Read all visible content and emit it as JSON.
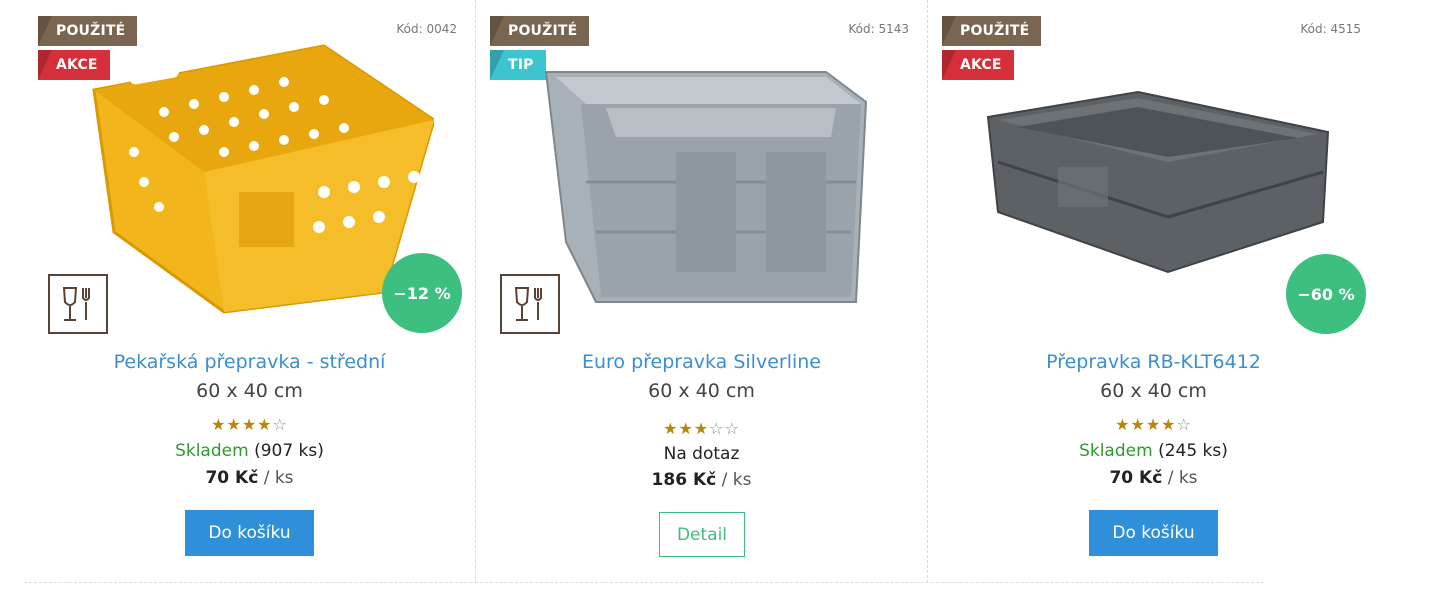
{
  "products": [
    {
      "badges": {
        "used": "POUŽITÉ",
        "second": "AKCE"
      },
      "code": "Kód: 0042",
      "discount": "−12 %",
      "title": "Pekařská přepravka - střední",
      "size": "60 x 40 cm",
      "rating": 4,
      "stock_status": "Skladem",
      "stock_count": "(907 ks)",
      "price": "70 Kč",
      "unit": "/ ks",
      "button": "Do košíku",
      "icon": "food-safe-icon",
      "color": "#f2b51c"
    },
    {
      "badges": {
        "used": "POUŽITÉ",
        "second": "TIP"
      },
      "code": "Kód: 5143",
      "title": "Euro přepravka Silverline",
      "size": "60 x 40 cm",
      "rating": 3,
      "stock_text": "Na dotaz",
      "price": "186 Kč",
      "unit": "/ ks",
      "button": "Detail",
      "icon": "food-safe-icon",
      "color": "#9aa4ab"
    },
    {
      "badges": {
        "used": "POUŽITÉ",
        "second": "AKCE"
      },
      "code": "Kód: 4515",
      "discount": "−60 %",
      "title": "Přepravka RB-KLT6412",
      "size": "60 x 40 cm",
      "rating": 4,
      "stock_status": "Skladem",
      "stock_count": "(245 ks)",
      "price": "70 Kč",
      "unit": "/ ks",
      "button": "Do košíku",
      "color": "#5c6166"
    }
  ],
  "colors": {
    "badge_used": "#7a6650",
    "badge_sale": "#d5303a",
    "badge_tip": "#3cc4cf",
    "discount": "#3dbf7f",
    "link": "#3a8fd0",
    "button": "#2f8fd8",
    "stock": "#2f9a2f",
    "star": "#b8860b"
  }
}
